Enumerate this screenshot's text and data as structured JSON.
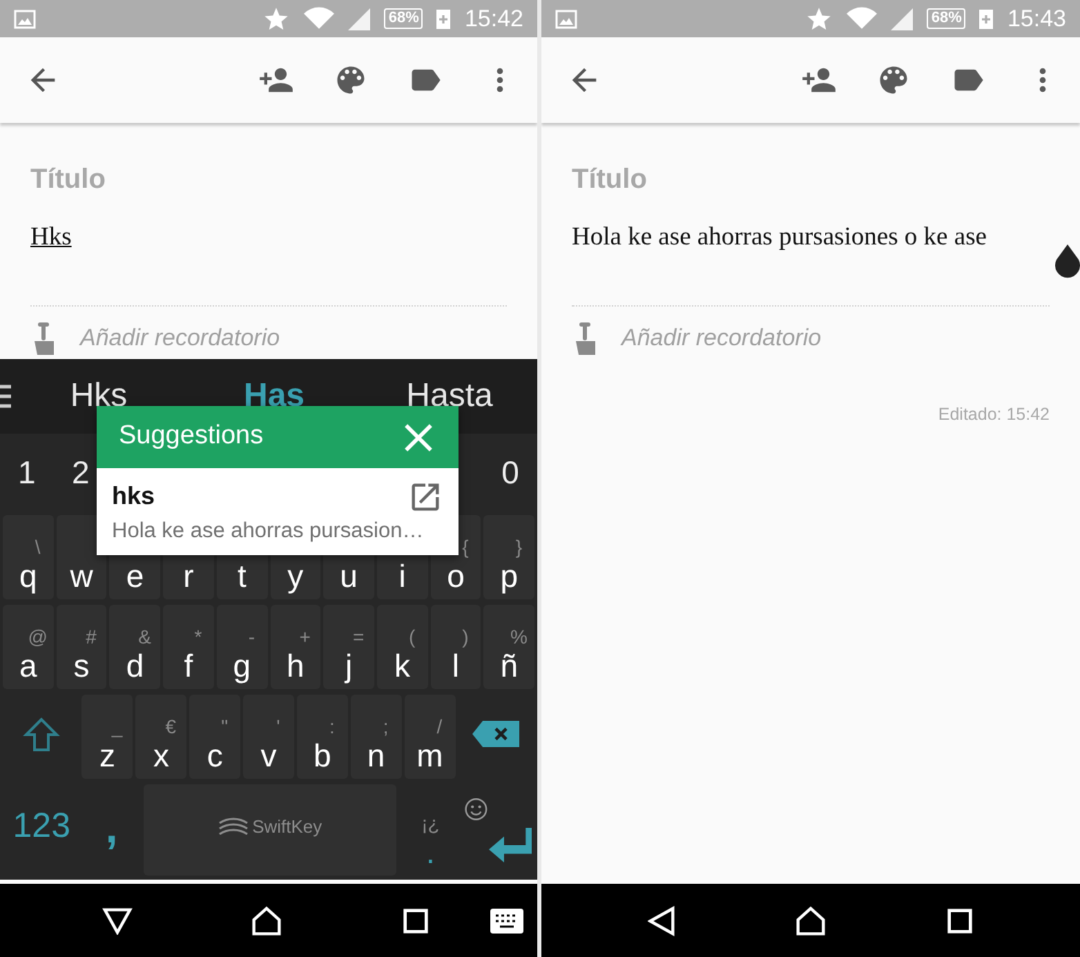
{
  "screens": [
    {
      "status_bar": {
        "battery": "68%",
        "time": "15:42"
      },
      "note": {
        "title_placeholder": "Título",
        "body": "Hks",
        "composing": true,
        "cursor_handle": false,
        "reminder": "Añadir recordatorio"
      },
      "keyboard": {
        "predictions": [
          {
            "text": "Hks",
            "selected": false
          },
          {
            "text": "Has",
            "selected": true
          },
          {
            "text": "Hasta",
            "selected": false
          }
        ],
        "number_row": [
          "1",
          "2",
          "0"
        ],
        "rows": [
          [
            {
              "kind": "letter",
              "label": "q",
              "hint": "\\"
            },
            {
              "kind": "letter",
              "label": "w"
            },
            {
              "kind": "letter",
              "label": "e"
            },
            {
              "kind": "letter",
              "label": "r"
            },
            {
              "kind": "letter",
              "label": "t"
            },
            {
              "kind": "letter",
              "label": "y"
            },
            {
              "kind": "letter",
              "label": "u"
            },
            {
              "kind": "letter",
              "label": "i"
            },
            {
              "kind": "letter",
              "label": "o",
              "hint": "{"
            },
            {
              "kind": "letter",
              "label": "p",
              "hint": "}"
            }
          ],
          [
            {
              "kind": "letter",
              "label": "a",
              "hint": "@"
            },
            {
              "kind": "letter",
              "label": "s",
              "hint": "#"
            },
            {
              "kind": "letter",
              "label": "d",
              "hint": "&"
            },
            {
              "kind": "letter",
              "label": "f",
              "hint": "*"
            },
            {
              "kind": "letter",
              "label": "g",
              "hint": "-"
            },
            {
              "kind": "letter",
              "label": "h",
              "hint": "+"
            },
            {
              "kind": "letter",
              "label": "j",
              "hint": "="
            },
            {
              "kind": "letter",
              "label": "k",
              "hint": "("
            },
            {
              "kind": "letter",
              "label": "l",
              "hint": ")"
            },
            {
              "kind": "letter",
              "label": "ñ",
              "hint": "%"
            }
          ],
          [
            {
              "kind": "shift"
            },
            {
              "kind": "letter",
              "label": "z",
              "hint": "_"
            },
            {
              "kind": "letter",
              "label": "x",
              "hint": "€"
            },
            {
              "kind": "letter",
              "label": "c",
              "hint": "\""
            },
            {
              "kind": "letter",
              "label": "v",
              "hint": "'"
            },
            {
              "kind": "letter",
              "label": "b",
              "hint": ":"
            },
            {
              "kind": "letter",
              "label": "n",
              "hint": ";"
            },
            {
              "kind": "letter",
              "label": "m",
              "hint": "/"
            },
            {
              "kind": "backspace"
            }
          ]
        ],
        "bottom_row": [
          {
            "kind": "numbers",
            "label": "123"
          },
          {
            "kind": "comma",
            "label": ","
          },
          {
            "kind": "space",
            "label": "SwiftKey"
          },
          {
            "kind": "period",
            "label": ".",
            "hint": "¡¿"
          },
          {
            "kind": "enter"
          }
        ],
        "popup": {
          "title": "Suggestions",
          "item_title": "hks",
          "item_text": "Hola ke ase ahorras pursasion…"
        }
      },
      "nav_bar": {
        "keyboard_open": true
      }
    },
    {
      "status_bar": {
        "battery": "68%",
        "time": "15:43"
      },
      "note": {
        "title_placeholder": "Título",
        "body": "Hola ke ase ahorras pursasiones o ke ase",
        "composing": false,
        "cursor_handle": true,
        "reminder": "Añadir recordatorio",
        "edited": "Editado: 15:42"
      },
      "nav_bar": {
        "keyboard_open": false
      }
    }
  ]
}
